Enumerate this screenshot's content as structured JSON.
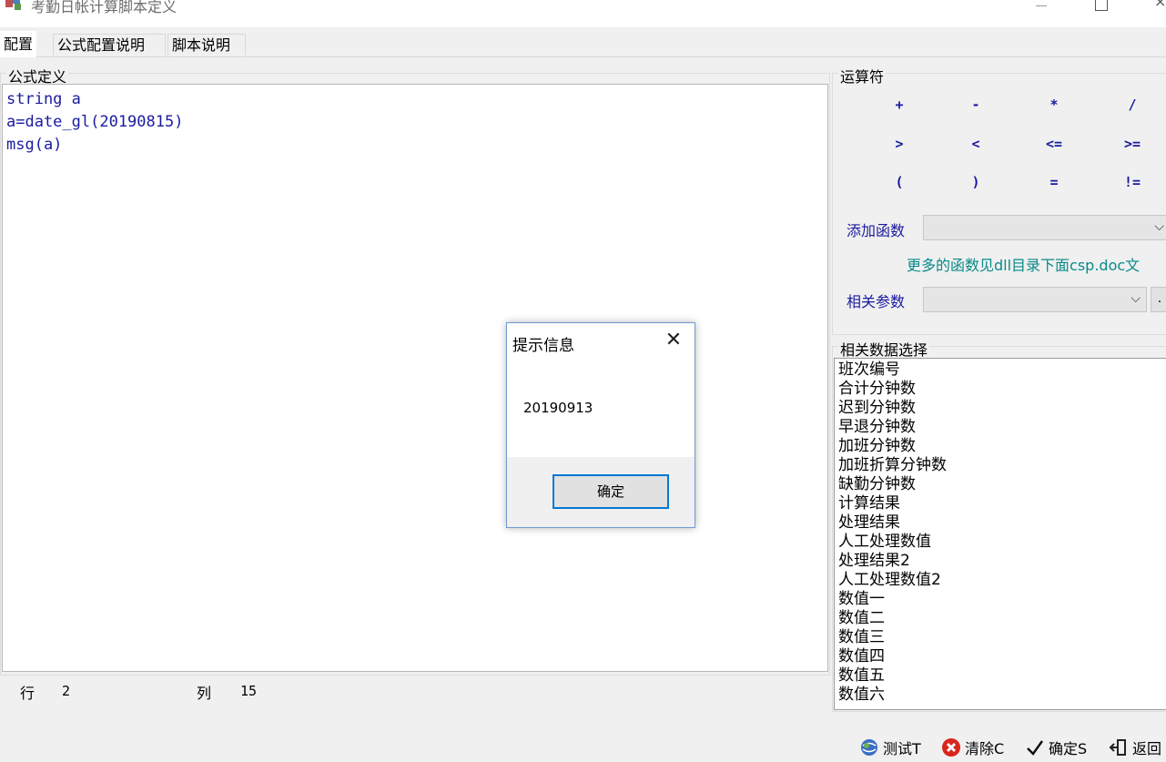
{
  "window": {
    "title": "考勤日帐计算脚本定义",
    "close_glyph": "×"
  },
  "tabs": [
    {
      "label": "配置"
    },
    {
      "label": "公式配置说明"
    },
    {
      "label": "脚本说明"
    }
  ],
  "formula": {
    "group_title": "公式定义",
    "lines": [
      "string a",
      "a=date_gl(20190815)",
      "msg(a)"
    ]
  },
  "status": {
    "row_label": "行",
    "row_value": "2",
    "col_label": "列",
    "col_value": "15"
  },
  "operators": {
    "group_title": "运算符",
    "items": [
      "+",
      "-",
      "*",
      "/",
      ">",
      "<",
      "<=",
      ">=",
      "(",
      ")",
      "=",
      "!="
    ]
  },
  "functions": {
    "add_label": "添加函数",
    "add_value": "",
    "note": "更多的函数见dll目录下面csp.doc文",
    "param_label": "相关参数",
    "param_value": "",
    "param_button": "."
  },
  "data_select": {
    "group_title": "相关数据选择",
    "items": [
      "班次编号",
      "合计分钟数",
      "迟到分钟数",
      "早退分钟数",
      "加班分钟数",
      "加班折算分钟数",
      "缺勤分钟数",
      "计算结果",
      "处理结果",
      "人工处理数值",
      "处理结果2",
      "人工处理数值2",
      "数值一",
      "数值二",
      "数值三",
      "数值四",
      "数值五",
      "数值六"
    ]
  },
  "buttons": {
    "test": "测试T",
    "clear": "清除C",
    "confirm": "确定S",
    "back": "返回"
  },
  "dialog": {
    "title": "提示信息",
    "close_glyph": "✕",
    "message": "20190913",
    "ok": "确定"
  },
  "colors": {
    "code_text": "#1a1aa0",
    "note_text": "#0a8a8a",
    "dialog_accent": "#0078d7"
  }
}
